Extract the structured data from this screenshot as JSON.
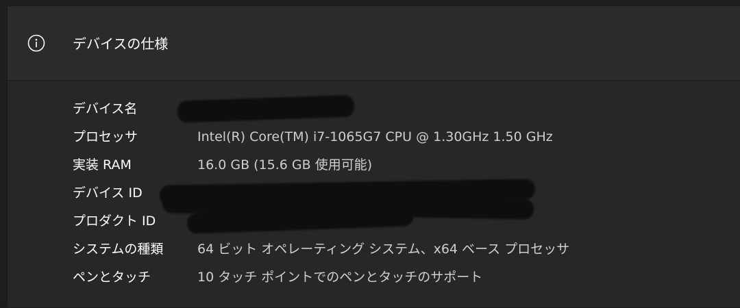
{
  "header": {
    "title": "デバイスの仕様",
    "icon": "info-icon"
  },
  "specs": [
    {
      "label": "デバイス名",
      "value": ""
    },
    {
      "label": "プロセッサ",
      "value": "Intel(R) Core(TM) i7-1065G7 CPU @ 1.30GHz   1.50 GHz"
    },
    {
      "label": "実装 RAM",
      "value": "16.0 GB (15.6 GB 使用可能)"
    },
    {
      "label": "デバイス ID",
      "value": ""
    },
    {
      "label": "プロダクト ID",
      "value": ""
    },
    {
      "label": "システムの種類",
      "value": "64 ビット オペレーティング システム、x64 ベース プロセッサ"
    },
    {
      "label": "ペンとタッチ",
      "value": "10 タッチ ポイントでのペンとタッチのサポート"
    }
  ]
}
